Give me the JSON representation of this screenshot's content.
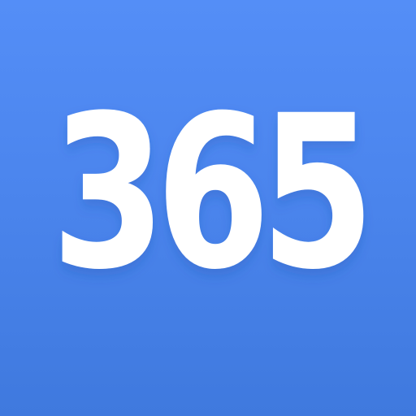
{
  "app_icon": {
    "label": "365",
    "background_color_top": "#548ef7",
    "background_color_bottom": "#3f79de",
    "text_color": "#ffffff"
  }
}
